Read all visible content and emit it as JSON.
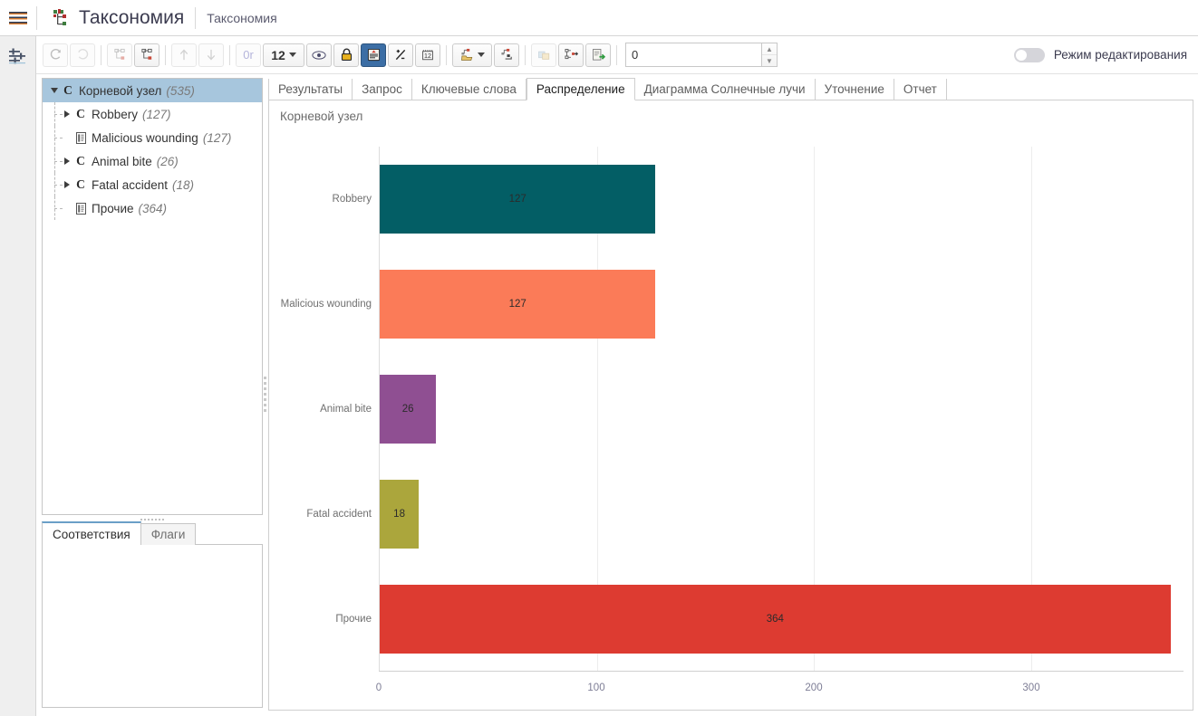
{
  "header": {
    "menu_icon": "hamburger-icon",
    "logo_icon": "taxonomy-tree-icon",
    "title": "Таксономия",
    "breadcrumb": "Таксономия"
  },
  "rail": {
    "settings_icon": "sliders-icon"
  },
  "toolbar": {
    "buttons": [
      {
        "name": "redo-button",
        "icon": "redo-arrow-icon",
        "disabled": true
      },
      {
        "name": "undo-button",
        "icon": "undo-arrow-icon",
        "disabled": true
      },
      {
        "name": "expand-tree-button",
        "icon": "tree-expand-icon",
        "disabled": true
      },
      {
        "name": "collapse-tree-button",
        "icon": "tree-collapse-icon",
        "disabled": false
      },
      {
        "name": "move-up-button",
        "icon": "arrow-up-icon",
        "disabled": true
      },
      {
        "name": "move-down-button",
        "icon": "arrow-down-icon",
        "disabled": true
      }
    ],
    "or_label": "0r",
    "level_value": "12",
    "preview_icon": "eye-icon",
    "lock_icon": "lock-icon",
    "distribution_icon": "distribution-chart-icon",
    "ratio_icon": "plus-minus-icon",
    "calendar_value": "12",
    "node_menu_icon": "node-folder-icon",
    "node_move_icon": "node-move-icon",
    "copy_icon": "copy-icon",
    "node-export_icon": "node-export-icon",
    "export_icon": "export-green-arrow-icon",
    "spinner_value": "0",
    "edit_mode_label": "Режим редактирования",
    "edit_mode_on": false
  },
  "tree": {
    "nodes": [
      {
        "label": "Корневой узел",
        "count": "(535)",
        "icon": "class-c-icon",
        "twisty": "down",
        "depth": 0,
        "selected": true
      },
      {
        "label": "Robbery",
        "count": "(127)",
        "icon": "class-c-icon",
        "twisty": "right",
        "depth": 1,
        "selected": false
      },
      {
        "label": "Malicious wounding",
        "count": "(127)",
        "icon": "document-icon",
        "twisty": "none",
        "depth": 1,
        "selected": false
      },
      {
        "label": "Animal bite",
        "count": "(26)",
        "icon": "class-c-icon",
        "twisty": "right",
        "depth": 1,
        "selected": false
      },
      {
        "label": "Fatal accident",
        "count": "(18)",
        "icon": "class-c-icon",
        "twisty": "right",
        "depth": 1,
        "selected": false
      },
      {
        "label": "Прочие",
        "count": "(364)",
        "icon": "document-icon",
        "twisty": "none",
        "depth": 1,
        "selected": false
      }
    ]
  },
  "left_bottom": {
    "tabs": [
      {
        "label": "Соответствия",
        "active": true
      },
      {
        "label": "Флаги",
        "active": false
      }
    ]
  },
  "main_tabs": [
    {
      "label": "Результаты",
      "active": false
    },
    {
      "label": "Запрос",
      "active": false
    },
    {
      "label": "Ключевые слова",
      "active": false
    },
    {
      "label": "Распределение",
      "active": true
    },
    {
      "label": "Диаграмма Солнечные лучи",
      "active": false
    },
    {
      "label": "Уточнение",
      "active": false
    },
    {
      "label": "Отчет",
      "active": false
    }
  ],
  "chart_data": {
    "type": "bar",
    "orientation": "horizontal",
    "title": "Корневой узел",
    "xlabel": "",
    "ylabel": "",
    "categories": [
      "Robbery",
      "Malicious wounding",
      "Animal bite",
      "Fatal accident",
      "Прочие"
    ],
    "values": [
      127,
      127,
      26,
      18,
      364
    ],
    "colors": [
      "#035e65",
      "#fb7b58",
      "#8f4f92",
      "#aba63c",
      "#dd3b31"
    ],
    "xlim": [
      0,
      370
    ],
    "xticks": [
      0,
      100,
      200,
      300
    ],
    "xtick_labels": [
      "0",
      "100",
      "200",
      "300"
    ],
    "grid": true,
    "legend": false
  }
}
